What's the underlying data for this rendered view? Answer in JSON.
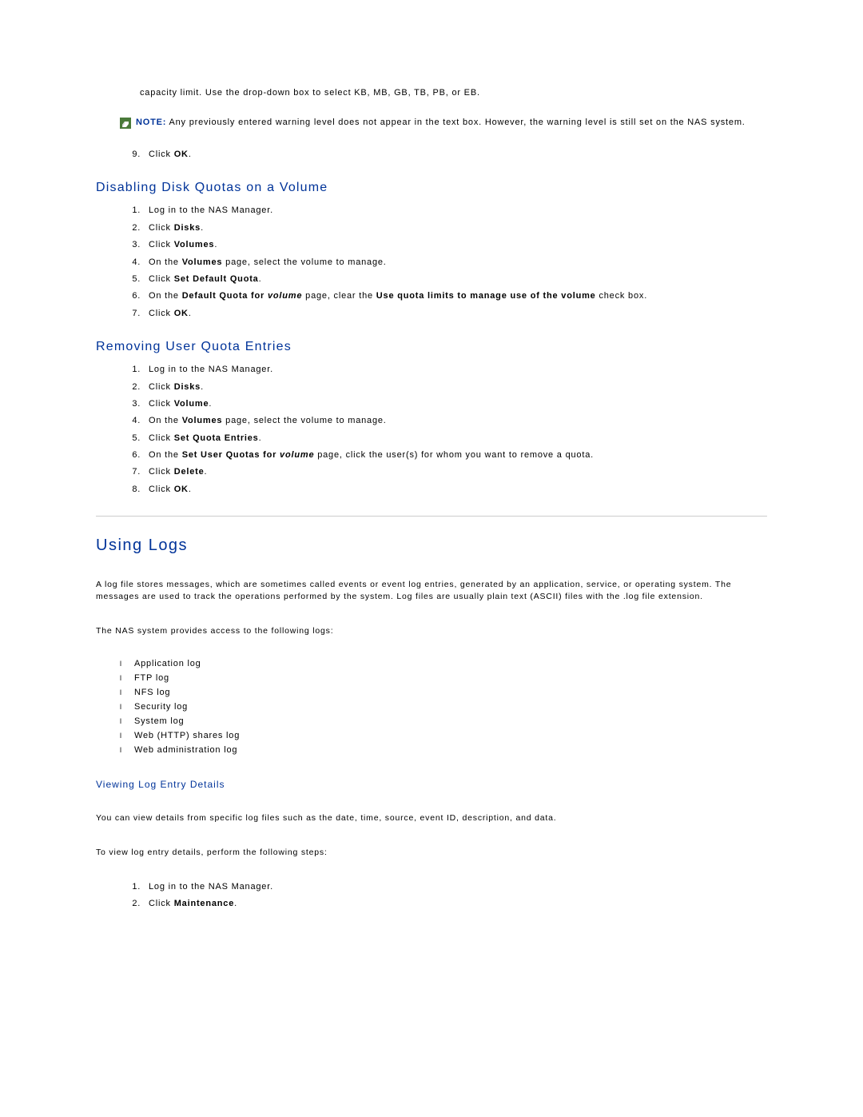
{
  "fragment_text": "capacity limit. Use the drop-down box to select KB, MB, GB, TB, PB, or EB.",
  "note": {
    "label": "NOTE:",
    "text": "Any previously entered warning level does not appear in the text box. However, the warning level is still set on the NAS system."
  },
  "step9": {
    "pre": "Click ",
    "bold": "OK",
    "post": "."
  },
  "disabling": {
    "title": "Disabling Disk Quotas on a Volume",
    "steps": {
      "s1": "Log in to the NAS Manager.",
      "s2": {
        "pre": "Click ",
        "bold": "Disks",
        "post": "."
      },
      "s3": {
        "pre": "Click ",
        "bold": "Volumes",
        "post": "."
      },
      "s4": {
        "pre": "On the ",
        "bold": "Volumes",
        "post": " page, select the volume to manage."
      },
      "s5": {
        "pre": "Click ",
        "bold": "Set Default Quota",
        "post": "."
      },
      "s6": {
        "pre": "On the ",
        "bold": "Default Quota for ",
        "italic": "volume",
        "post1": " page, clear the ",
        "bold2": "Use quota limits to manage use of the volume",
        "post2": " check box."
      },
      "s7": {
        "pre": "Click ",
        "bold": "OK",
        "post": "."
      }
    }
  },
  "removing": {
    "title": "Removing User Quota Entries",
    "steps": {
      "s1": "Log in to the NAS Manager.",
      "s2": {
        "pre": "Click ",
        "bold": "Disks",
        "post": "."
      },
      "s3": {
        "pre": "Click ",
        "bold": "Volume",
        "post": "."
      },
      "s4": {
        "pre": "On the ",
        "bold": "Volumes",
        "post": " page, select the volume to manage."
      },
      "s5": {
        "pre": "Click ",
        "bold": "Set Quota Entries",
        "post": "."
      },
      "s6": {
        "pre": "On the ",
        "bold": "Set User Quotas for ",
        "italic": "volume",
        "post": " page, click the user(s) for whom you want to remove a quota."
      },
      "s7": {
        "pre": "Click ",
        "bold": "Delete",
        "post": "."
      },
      "s8": {
        "pre": "Click ",
        "bold": "OK",
        "post": "."
      }
    }
  },
  "logs": {
    "title": "Using Logs",
    "para1": "A log file stores messages, which are sometimes called events or event log entries, generated by an application, service, or operating system. The messages are used to track the operations performed by the system. Log files are usually plain text (ASCII) files with the .log file extension.",
    "para2": "The NAS system provides access to the following logs:",
    "items": {
      "i1": "Application log",
      "i2": "FTP log",
      "i3": "NFS log",
      "i4": "Security log",
      "i5": "System log",
      "i6": "Web (HTTP) shares log",
      "i7": "Web administration log"
    },
    "viewing": {
      "title": "Viewing Log Entry Details",
      "para1": "You can view details from specific log files such as the date, time, source, event ID, description, and data.",
      "para2": "To view log entry details, perform the following steps:",
      "steps": {
        "s1": "Log in to the NAS Manager.",
        "s2": {
          "pre": "Click ",
          "bold": "Maintenance",
          "post": "."
        }
      }
    }
  }
}
